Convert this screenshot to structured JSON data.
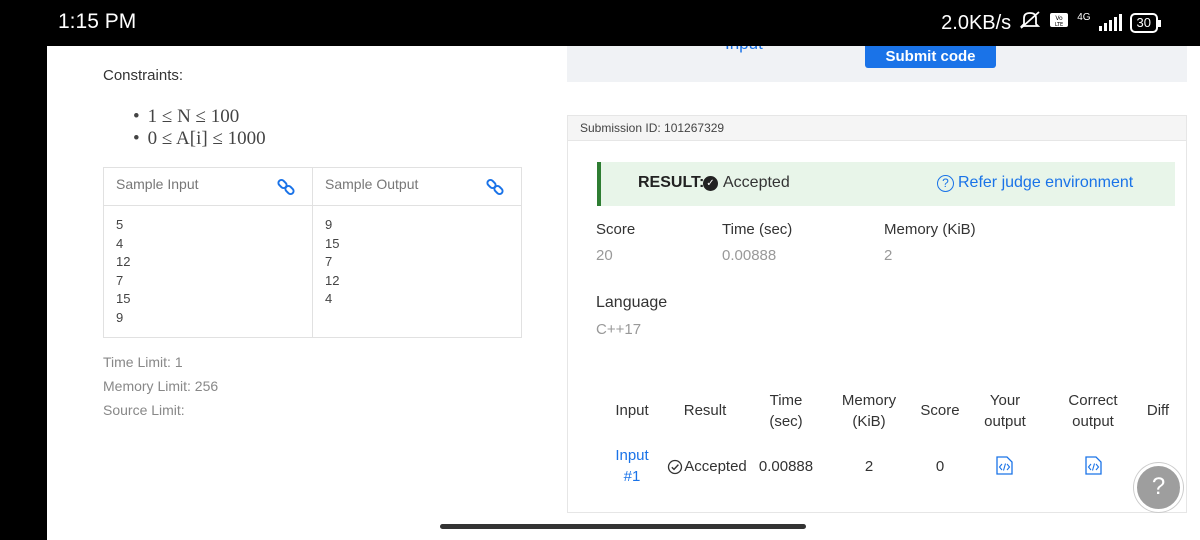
{
  "statusbar": {
    "time": "1:15 PM",
    "speed": "2.0KB/s",
    "network": "4G",
    "battery": "30"
  },
  "problem": {
    "constraints_title": "Constraints:",
    "constraints": [
      "1 ≤ N ≤ 100",
      "0 ≤ A[i] ≤ 1000"
    ],
    "sample_input_label": "Sample Input",
    "sample_output_label": "Sample Output",
    "sample_input": [
      "5",
      "4",
      "12",
      "7",
      "15",
      "9"
    ],
    "sample_output": [
      "9",
      "15",
      "7",
      "12",
      "4"
    ],
    "time_limit": "Time Limit: 1",
    "memory_limit": "Memory Limit: 256",
    "source_limit": "Source Limit:"
  },
  "editor_bar": {
    "input_tab": "Input",
    "submit_label": "Submit code"
  },
  "submission": {
    "id_label": "Submission ID: 101267329",
    "result_label": "RESULT:",
    "result_value": "Accepted",
    "refer_label": "Refer judge environment",
    "score_label": "Score",
    "score_value": "20",
    "time_label": "Time (sec)",
    "time_value": "0.00888",
    "memory_label": "Memory (KiB)",
    "memory_value": "2",
    "language_label": "Language",
    "language_value": "C++17"
  },
  "results_table": {
    "headers": {
      "input": "Input",
      "result": "Result",
      "time1": "Time",
      "time2": "(sec)",
      "memory1": "Memory",
      "memory2": "(KiB)",
      "score": "Score",
      "your1": "Your",
      "your2": "output",
      "correct1": "Correct",
      "correct2": "output",
      "diff": "Diff"
    },
    "rows": [
      {
        "input1": "Input",
        "input2": "#1",
        "result": "Accepted",
        "time": "0.00888",
        "memory": "2",
        "score": "0"
      }
    ]
  },
  "help_icon": "question-mark-icon"
}
